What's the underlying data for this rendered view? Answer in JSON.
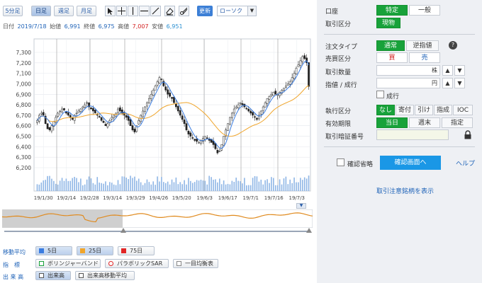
{
  "toolbar": {
    "period_buttons": [
      "5分足",
      "日足",
      "週足",
      "月足"
    ],
    "selected_period": "日足",
    "update_label": "更新",
    "chart_type": "ローソク"
  },
  "info": {
    "period": "日付",
    "date": "2019/7/18",
    "open_label": "始値",
    "open": "6,991",
    "close_label": "終値",
    "close": "6,975",
    "high_label": "高値",
    "high": "7,007",
    "low_label": "安値",
    "low": "6,951"
  },
  "chart_data": {
    "type": "candlestick",
    "y_ticks": [
      "7,300",
      "7,200",
      "7,100",
      "7,000",
      "6,900",
      "6,800",
      "6,700",
      "6,600",
      "6,500",
      "6,400",
      "6,300",
      "6,200"
    ],
    "x_ticks": [
      "19/1/30",
      "19/2/14",
      "19/2/28",
      "19/3/14",
      "19/3/29",
      "19/4/26",
      "19/5/20",
      "19/6/3",
      "19/6/17",
      "19/7/1",
      "19/7/16",
      "19/7/3"
    ],
    "ylim": [
      6200,
      7300
    ],
    "close": [
      6650,
      6700,
      6720,
      6700,
      6620,
      6570,
      6560,
      6600,
      6640,
      6680,
      6720,
      6740,
      6760,
      6750,
      6720,
      6700,
      6680,
      6660,
      6700,
      6720,
      6740,
      6760,
      6780,
      6800,
      6820,
      6780,
      6760,
      6740,
      6720,
      6700,
      6680,
      6650,
      6630,
      6600,
      6620,
      6650,
      6680,
      6700,
      6720,
      6760,
      6740,
      6720,
      6700,
      6680,
      6650,
      6600,
      6560,
      6540,
      6600,
      6650,
      6700,
      6740,
      6780,
      6820,
      6860,
      6900,
      6940,
      6980,
      7020,
      7060,
      7040,
      6980,
      6940,
      6900,
      6880,
      6860,
      6820,
      6780,
      6740,
      6700,
      6660,
      6620,
      6560,
      6520,
      6500,
      6480,
      6460,
      6450,
      6440,
      6460,
      6480,
      6500,
      6480,
      6460,
      6440,
      6420,
      6380,
      6340,
      6360,
      6420,
      6500,
      6560,
      6620,
      6680,
      6720,
      6760,
      6780,
      6800,
      6820,
      6800,
      6780,
      6760,
      6740,
      6720,
      6700,
      6680,
      6660,
      6700,
      6740,
      6780,
      6820,
      6860,
      6880,
      6900,
      6920,
      6900,
      6900,
      6920,
      6940,
      6960,
      6980,
      7000,
      7020,
      7060,
      7100,
      7150,
      7180,
      7220,
      7260,
      7240,
      7200,
      6975
    ]
  },
  "indicators": {
    "ma_label": "移動平均",
    "ma": [
      {
        "label": "5日",
        "color": "#3a7ce0"
      },
      {
        "label": "25日",
        "color": "#f0a52b"
      },
      {
        "label": "75日",
        "color": "#e12626"
      }
    ],
    "index_label": "指　標",
    "index_items": [
      "ボリンジャーバンド",
      "パラボリックSAR",
      "一目均衡表"
    ],
    "volume_label": "出 来 高",
    "volume_items": [
      "出来高",
      "出来高移動平均"
    ]
  },
  "order": {
    "account_label": "口座",
    "account_options": [
      "特定",
      "一般"
    ],
    "trade_type_label": "取引区分",
    "trade_type": "現物",
    "order_type_label": "注文タイプ",
    "order_type_options": [
      "通常",
      "逆指値"
    ],
    "side_label": "売買区分",
    "side_options": [
      "買",
      "売"
    ],
    "qty_label": "取引数量",
    "qty_unit": "株",
    "price_label": "指値 / 成行",
    "price_unit": "円",
    "market_label": "成行",
    "condition_label": "執行区分",
    "condition_options": [
      "なし",
      "寄付",
      "引け",
      "指成",
      "IOC"
    ],
    "expiry_label": "有効期限",
    "expiry_options": [
      "当日",
      "週末",
      "指定"
    ],
    "pin_label": "取引暗証番号",
    "skip_confirm_label": "確認省略",
    "confirm_button": "確認画面へ",
    "help_label": "ヘルプ",
    "notice_link": "取引注意銘柄を表示"
  }
}
